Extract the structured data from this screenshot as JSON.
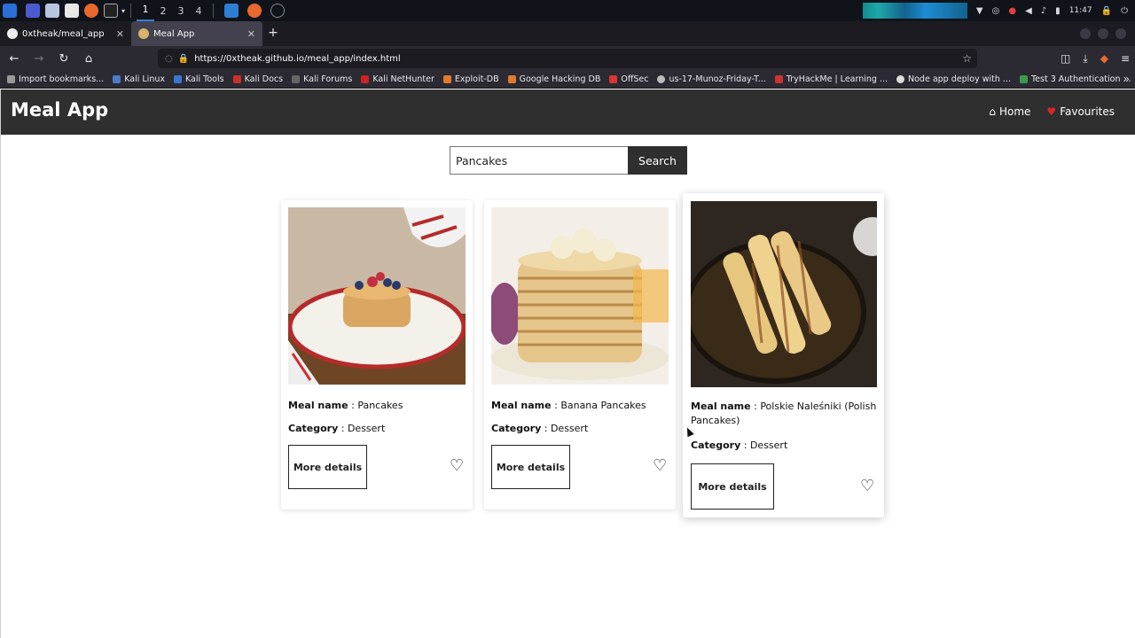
{
  "taskbar": {
    "workspaces": [
      "1",
      "2",
      "3",
      "4"
    ],
    "clock": "11:47"
  },
  "browser": {
    "tabs": [
      {
        "title": "0xtheak/meal_app",
        "active": false
      },
      {
        "title": "Meal App",
        "active": true
      }
    ],
    "url": "https://0xtheak.github.io/meal_app/index.html",
    "bookmarks": [
      "Import bookmarks...",
      "Kali Linux",
      "Kali Tools",
      "Kali Docs",
      "Kali Forums",
      "Kali NetHunter",
      "Exploit-DB",
      "Google Hacking DB",
      "OffSec",
      "us-17-Munoz-Friday-T...",
      "TryHackMe | Learning ...",
      "Node app deploy with ...",
      "Test 3 Authentication ..."
    ]
  },
  "site": {
    "brand": "Meal App",
    "nav": {
      "home": "Home",
      "favourites": "Favourites"
    },
    "search": {
      "value": "Pancakes",
      "button": "Search"
    },
    "meal_label": "Meal name",
    "category_label": "Category",
    "details_label": "More details",
    "meals": [
      {
        "name": "Pancakes",
        "category": "Dessert"
      },
      {
        "name": "Banana Pancakes",
        "category": "Dessert"
      },
      {
        "name": "Polskie Naleśniki (Polish Pancakes)",
        "category": "Dessert"
      }
    ]
  }
}
